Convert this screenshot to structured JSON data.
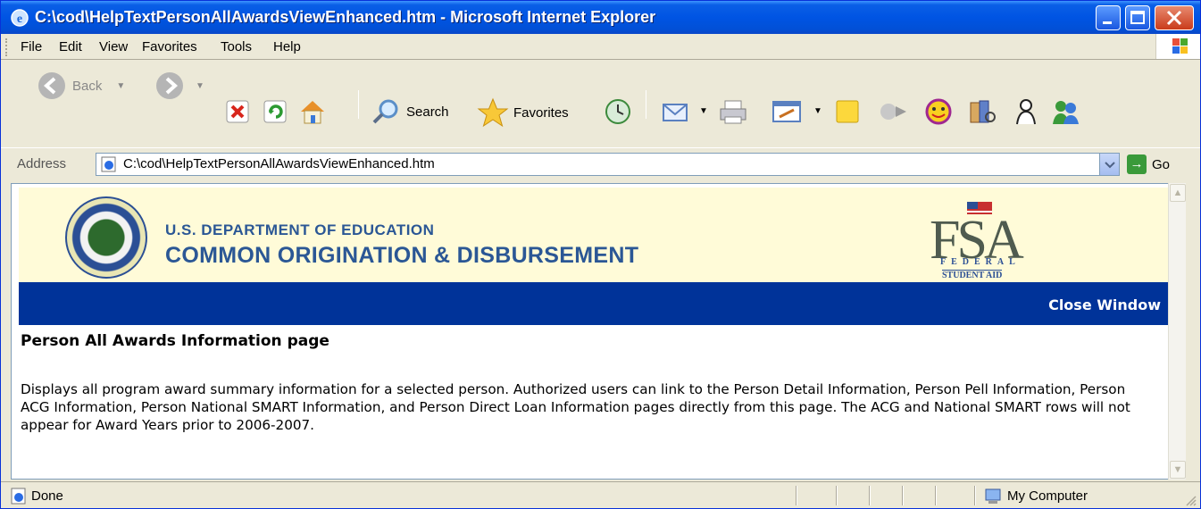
{
  "window": {
    "title": "C:\\cod\\HelpTextPersonAllAwardsViewEnhanced.htm - Microsoft Internet Explorer"
  },
  "menu": {
    "items": [
      "File",
      "Edit",
      "View",
      "Favorites",
      "Tools",
      "Help"
    ]
  },
  "toolbar": {
    "back_label": "Back",
    "search_label": "Search",
    "favorites_label": "Favorites"
  },
  "address": {
    "label": "Address",
    "value": "C:\\cod\\HelpTextPersonAllAwardsViewEnhanced.htm",
    "go_label": "Go"
  },
  "banner": {
    "org_line1": "U.S. DEPARTMENT OF EDUCATION",
    "org_line2": "COMMON ORIGINATION & DISBURSEMENT",
    "fsa_logo": "FSA",
    "fsa_federal": "FEDERAL",
    "fsa_student_aid": "STUDENT AID",
    "close_window": "Close Window"
  },
  "page": {
    "heading": "Person All Awards Information page",
    "paragraph": "Displays all program award summary information for a selected person. Authorized users can link to the Person Detail Information, Person Pell Information, Person ACG Information, Person National SMART Information, and Person Direct Loan Information pages directly from this page. The ACG and National SMART rows will not appear for Award Years prior to 2006-2007."
  },
  "status": {
    "text": "Done",
    "zone": "My Computer"
  },
  "colors": {
    "titlebar": "#0054e3",
    "banner_bg": "#fffbd8",
    "bluebar": "#003399",
    "org_text": "#2b5795"
  }
}
